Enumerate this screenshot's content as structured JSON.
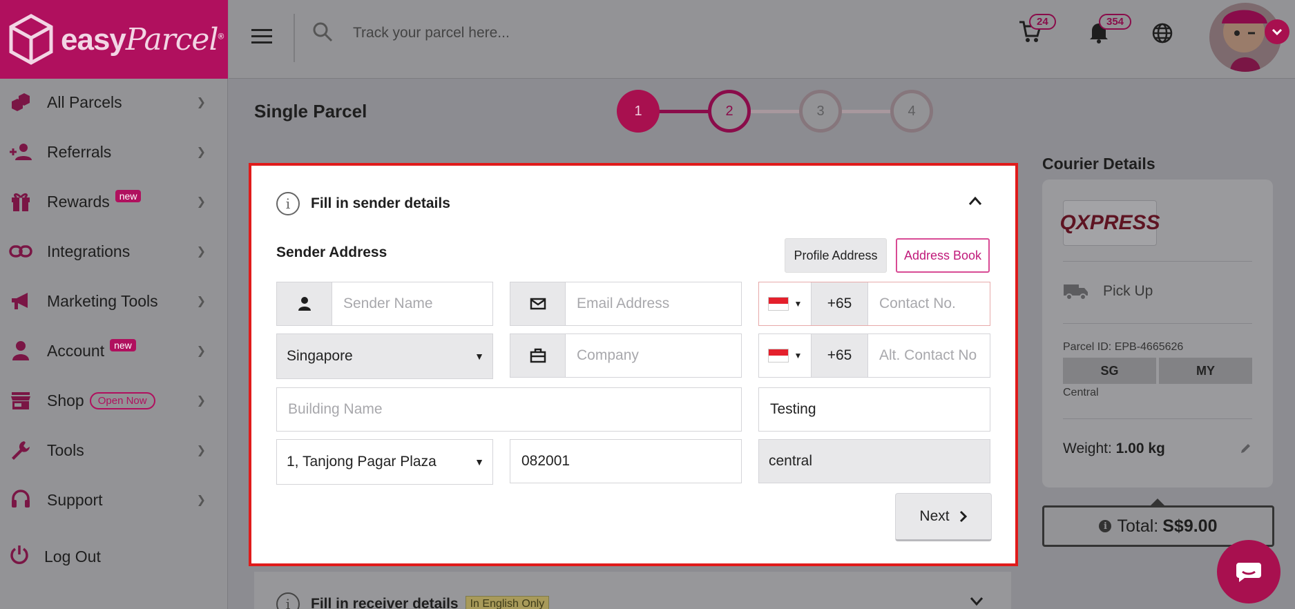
{
  "brand": {
    "name": "easy",
    "script": "Parcel",
    "mark": "®"
  },
  "sidebar": {
    "items": [
      {
        "label": "All Parcels",
        "badge": "",
        "icon": "boxes-icon"
      },
      {
        "label": "Referrals",
        "badge": "",
        "icon": "add-user-icon"
      },
      {
        "label": "Rewards",
        "badge": "new",
        "icon": "gift-icon"
      },
      {
        "label": "Integrations",
        "badge": "",
        "icon": "link-icon"
      },
      {
        "label": "Marketing Tools",
        "badge": "",
        "icon": "megaphone-icon"
      },
      {
        "label": "Account",
        "badge": "new",
        "icon": "user-icon"
      },
      {
        "label": "Shop",
        "badge": "Open Now",
        "icon": "store-icon"
      },
      {
        "label": "Tools",
        "badge": "",
        "icon": "wrench-icon"
      },
      {
        "label": "Support",
        "badge": "",
        "icon": "headset-icon"
      }
    ],
    "logout": "Log Out"
  },
  "topbar": {
    "search_placeholder": "Track your parcel here...",
    "cart_count": "24",
    "notification_count": "354"
  },
  "page": {
    "title": "Single Parcel"
  },
  "stepper": {
    "steps": [
      "1",
      "2",
      "3",
      "4"
    ],
    "current": 1
  },
  "sender": {
    "section_title": "Fill in sender details",
    "address_label": "Sender Address",
    "profile_address_btn": "Profile Address",
    "address_book_btn": "Address Book",
    "name_placeholder": "Sender Name",
    "email_placeholder": "Email Address",
    "phone_code": "+65",
    "contact_placeholder": "Contact No.",
    "country": "Singapore",
    "company_placeholder": "Company",
    "alt_phone_code": "+65",
    "alt_contact_placeholder": "Alt. Contact No",
    "building_placeholder": "Building Name",
    "building_value": "Testing",
    "street": "1, Tanjong Pagar Plaza",
    "postcode": "082001",
    "area": "central",
    "next_btn": "Next"
  },
  "receiver": {
    "section_title": "Fill in receiver details",
    "badge": "In English Only"
  },
  "courier": {
    "title": "Courier Details",
    "logo_text": "QXPRESS",
    "service": "Pick Up",
    "parcel_id": "Parcel ID: EPB-4665626",
    "from": "SG",
    "to": "MY",
    "region": "Central",
    "weight_label": "Weight:",
    "weight_value": "1.00 kg",
    "total_label": "Total:",
    "total_value": "S$9.00"
  },
  "colors": {
    "brand": "#b0105e",
    "highlight_border": "#e01b1b"
  }
}
